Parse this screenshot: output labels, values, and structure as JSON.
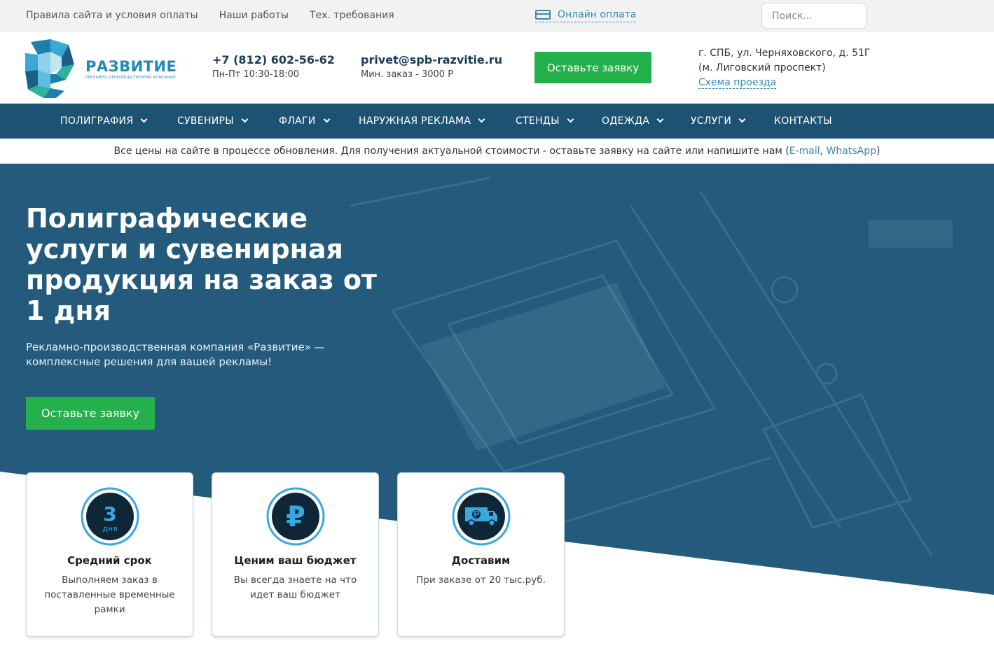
{
  "topbar": {
    "links": [
      "Правила сайта и условия оплаты",
      "Наши работы",
      "Тех. требования"
    ],
    "online_payment": "Онлайн оплата",
    "search_placeholder": "Поиск..."
  },
  "header": {
    "logo_title": "РАЗВИТИЕ",
    "logo_subtitle": "РЕКЛАМНО-ПРОИЗВОДСТВЕННАЯ КОМПАНИЯ",
    "phone": "+7 (812) 602-56-62",
    "hours": "Пн-Пт 10:30-18:00",
    "email": "privet@spb-razvitie.ru",
    "min_order": "Мин. заказ - 3000 Р",
    "cta": "Оставьте заявку",
    "address_line1": "г. СПБ, ул. Черняховского, д. 51Г",
    "address_line2": "(м. Лиговский проспект)",
    "route_link": "Схема проезда"
  },
  "nav": {
    "items": [
      {
        "label": "ПОЛИГРАФИЯ",
        "dropdown": true
      },
      {
        "label": "СУВЕНИРЫ",
        "dropdown": true
      },
      {
        "label": "ФЛАГИ",
        "dropdown": true
      },
      {
        "label": "НАРУЖНАЯ РЕКЛАМА",
        "dropdown": true
      },
      {
        "label": "СТЕНДЫ",
        "dropdown": true
      },
      {
        "label": "ОДЕЖДА",
        "dropdown": true
      },
      {
        "label": "УСЛУГИ",
        "dropdown": true
      },
      {
        "label": "КОНТАКТЫ",
        "dropdown": false
      }
    ]
  },
  "notice": {
    "text": "Все цены на сайте в процессе обновления. Для получения актуальной стоимости - оставьте заявку на сайте или напишите нам (",
    "email_link": "E-mail",
    "separator": ", ",
    "whatsapp_link": "WhatsApp",
    "closing": ")"
  },
  "hero": {
    "title": "Полиграфические услуги и сувенирная продукция на заказ от 1 дня",
    "lead": "Рекламно-производственная компания «Развитие» — комплексные решения для вашей рекламы!",
    "cta": "Оставьте заявку"
  },
  "features": [
    {
      "icon": "three-days-icon",
      "icon_number": "3",
      "icon_caption": "дня",
      "title": "Средний срок",
      "text": "Выполняем заказ в поставленные временные рамки"
    },
    {
      "icon": "ruble-icon",
      "icon_symbol": "₽",
      "title": "Ценим ваш бюджет",
      "text": "Вы всегда знаете на что идет ваш бюджет"
    },
    {
      "icon": "delivery-truck-icon",
      "title": "Доставим",
      "text": "При заказе от 20 тыс.руб."
    }
  ],
  "colors": {
    "nav_bg": "#1d5272",
    "hero_bg": "#235a7c",
    "accent_green": "#24b14b",
    "link_blue": "#3a86b5",
    "logo_blue": "#1f8ab8"
  }
}
